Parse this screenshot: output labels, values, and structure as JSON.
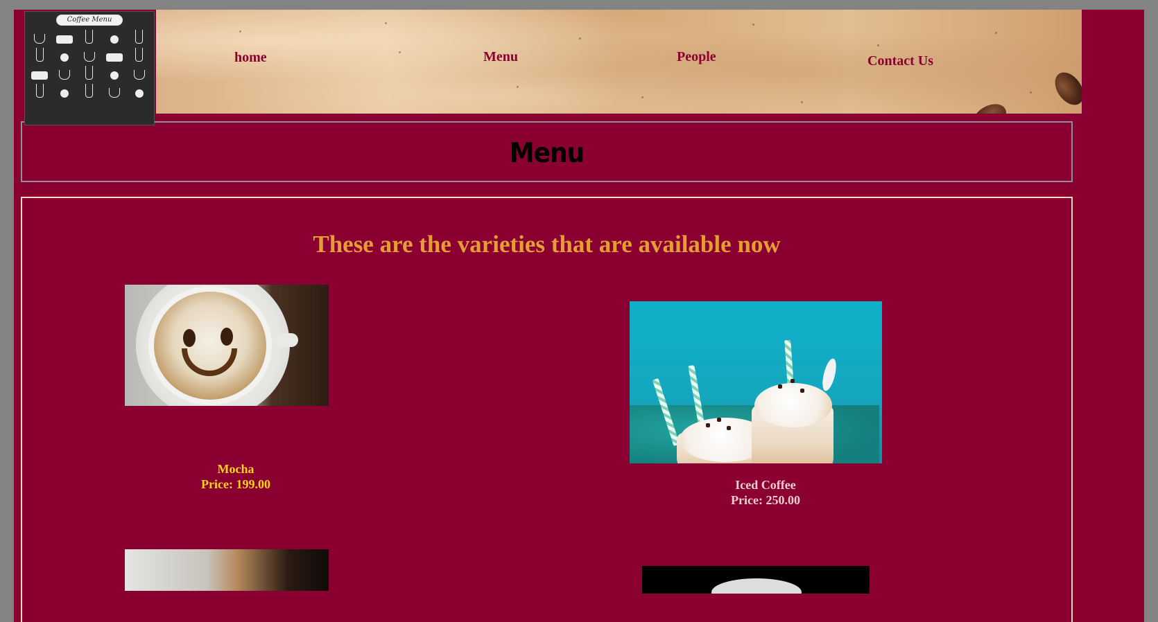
{
  "header": {
    "logo_title": "Coffee Menu",
    "nav": [
      "home",
      "Menu",
      "People",
      "Contact Us"
    ]
  },
  "page": {
    "title": "Menu",
    "subtitle": "These are the varieties that are available now"
  },
  "items": [
    {
      "name": "Mocha",
      "price": "Price: 199.00",
      "image": "latte-art-smiley"
    },
    {
      "name": "Iced Coffee",
      "price": "Price: 250.00",
      "image": "iced-coffee-glasses"
    },
    {
      "image": "espresso-cup"
    },
    {
      "image": "dark-coffee-photo"
    }
  ],
  "colors": {
    "background": "#8a0030",
    "frame": "#838383",
    "nav_text": "#8a0030",
    "subtitle": "#e59d35",
    "caption_gold": "#ffd21f",
    "caption_pink": "#f0cfcf",
    "content_border": "#f5ddc0"
  }
}
